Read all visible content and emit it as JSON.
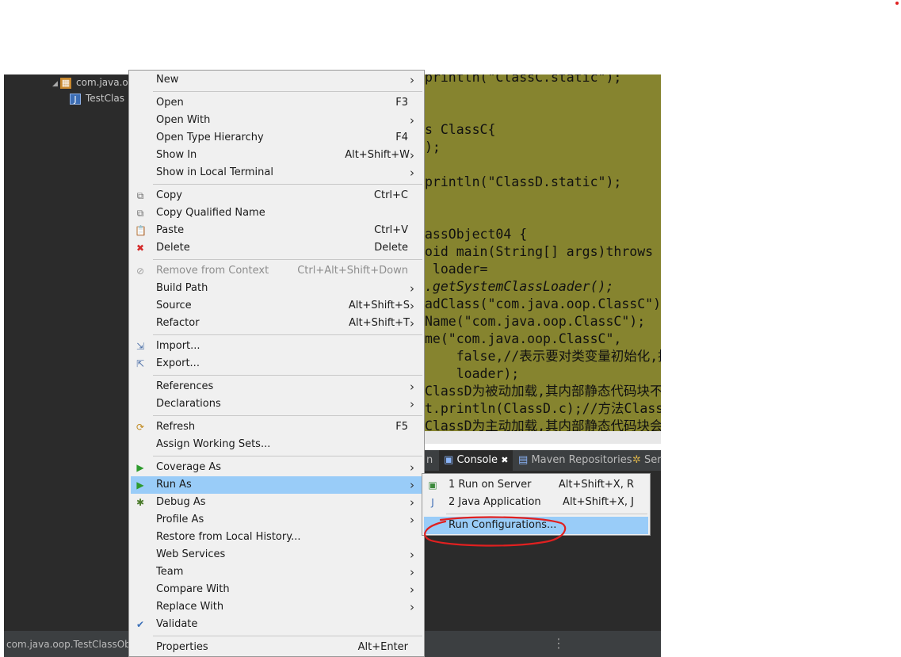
{
  "explorer": {
    "package": "com.java.o",
    "file": "TestClas"
  },
  "editor": {
    "lines": [
      {
        "text": "println(\"ClassC.static\");",
        "italic": false
      },
      {
        "text": "",
        "italic": false
      },
      {
        "text": "",
        "italic": false
      },
      {
        "text": "s ClassC{",
        "italic": false
      },
      {
        "text": ");",
        "italic": false
      },
      {
        "text": "",
        "italic": false
      },
      {
        "text": "println(\"ClassD.static\");",
        "italic": false
      },
      {
        "text": "",
        "italic": false
      },
      {
        "text": "",
        "italic": false
      },
      {
        "text": "assObject04 {",
        "italic": false
      },
      {
        "text": "oid main(String[] args)throws E",
        "italic": false
      },
      {
        "text": " loader=",
        "italic": false
      },
      {
        "text": ".getSystemClassLoader();",
        "italic": true
      },
      {
        "text": "adClass(\"com.java.oop.ClassC\");",
        "italic": false
      },
      {
        "text": "Name(\"com.java.oop.ClassC\");",
        "italic": false
      },
      {
        "text": "me(\"com.java.oop.ClassC\",",
        "italic": false
      },
      {
        "text": "    false,//表示要对类变量初始化,执行",
        "italic": false
      },
      {
        "text": "    loader);",
        "italic": false
      },
      {
        "text": "ClassD为被动加载,其内部静态代码块不会执",
        "italic": false
      },
      {
        "text": "t.println(ClassD.c);//方法ClassC",
        "italic": false
      },
      {
        "text": "ClassD为主动加载,其内部静态代码块会执行",
        "italic": false
      }
    ]
  },
  "console_tabs": {
    "left_partial": "n",
    "console": "Console",
    "close": "✖",
    "maven": "Maven Repositories",
    "right_partial": "Ser"
  },
  "status": {
    "text": "com.java.oop.TestClassObj",
    "dots": "⋮"
  },
  "context_menu": {
    "items": [
      {
        "label": "New",
        "accel": "",
        "submenu": true,
        "icon": "",
        "disabled": false,
        "highlighted": false
      },
      {
        "sep": true
      },
      {
        "label": "Open",
        "accel": "F3",
        "submenu": false,
        "icon": "",
        "disabled": false,
        "highlighted": false
      },
      {
        "label": "Open With",
        "accel": "",
        "submenu": true,
        "icon": "",
        "disabled": false,
        "highlighted": false
      },
      {
        "label": "Open Type Hierarchy",
        "accel": "F4",
        "submenu": false,
        "icon": "",
        "disabled": false,
        "highlighted": false
      },
      {
        "label": "Show In",
        "accel": "Alt+Shift+W",
        "submenu": true,
        "icon": "",
        "disabled": false,
        "highlighted": false
      },
      {
        "label": "Show in Local Terminal",
        "accel": "",
        "submenu": true,
        "icon": "",
        "disabled": false,
        "highlighted": false
      },
      {
        "sep": true
      },
      {
        "label": "Copy",
        "accel": "Ctrl+C",
        "submenu": false,
        "icon": "copy-icon",
        "disabled": false,
        "highlighted": false
      },
      {
        "label": "Copy Qualified Name",
        "accel": "",
        "submenu": false,
        "icon": "copy-qualified-name-icon",
        "disabled": false,
        "highlighted": false
      },
      {
        "label": "Paste",
        "accel": "Ctrl+V",
        "submenu": false,
        "icon": "paste-icon",
        "disabled": false,
        "highlighted": false
      },
      {
        "label": "Delete",
        "accel": "Delete",
        "submenu": false,
        "icon": "delete-icon",
        "disabled": false,
        "highlighted": false
      },
      {
        "sep": true
      },
      {
        "label": "Remove from Context",
        "accel": "Ctrl+Alt+Shift+Down",
        "submenu": false,
        "icon": "remove-context-icon",
        "disabled": true,
        "highlighted": false
      },
      {
        "label": "Build Path",
        "accel": "",
        "submenu": true,
        "icon": "",
        "disabled": false,
        "highlighted": false
      },
      {
        "label": "Source",
        "accel": "Alt+Shift+S",
        "submenu": true,
        "icon": "",
        "disabled": false,
        "highlighted": false
      },
      {
        "label": "Refactor",
        "accel": "Alt+Shift+T",
        "submenu": true,
        "icon": "",
        "disabled": false,
        "highlighted": false
      },
      {
        "sep": true
      },
      {
        "label": "Import...",
        "accel": "",
        "submenu": false,
        "icon": "import-icon",
        "disabled": false,
        "highlighted": false
      },
      {
        "label": "Export...",
        "accel": "",
        "submenu": false,
        "icon": "export-icon",
        "disabled": false,
        "highlighted": false
      },
      {
        "sep": true
      },
      {
        "label": "References",
        "accel": "",
        "submenu": true,
        "icon": "",
        "disabled": false,
        "highlighted": false
      },
      {
        "label": "Declarations",
        "accel": "",
        "submenu": true,
        "icon": "",
        "disabled": false,
        "highlighted": false
      },
      {
        "sep": true
      },
      {
        "label": "Refresh",
        "accel": "F5",
        "submenu": false,
        "icon": "refresh-icon",
        "disabled": false,
        "highlighted": false
      },
      {
        "label": "Assign Working Sets...",
        "accel": "",
        "submenu": false,
        "icon": "",
        "disabled": false,
        "highlighted": false
      },
      {
        "sep": true
      },
      {
        "label": "Coverage As",
        "accel": "",
        "submenu": true,
        "icon": "coverage-icon",
        "disabled": false,
        "highlighted": false
      },
      {
        "label": "Run As",
        "accel": "",
        "submenu": true,
        "icon": "run-icon",
        "disabled": false,
        "highlighted": true
      },
      {
        "label": "Debug As",
        "accel": "",
        "submenu": true,
        "icon": "debug-icon",
        "disabled": false,
        "highlighted": false
      },
      {
        "label": "Profile As",
        "accel": "",
        "submenu": true,
        "icon": "",
        "disabled": false,
        "highlighted": false
      },
      {
        "label": "Restore from Local History...",
        "accel": "",
        "submenu": false,
        "icon": "",
        "disabled": false,
        "highlighted": false
      },
      {
        "label": "Web Services",
        "accel": "",
        "submenu": true,
        "icon": "",
        "disabled": false,
        "highlighted": false
      },
      {
        "label": "Team",
        "accel": "",
        "submenu": true,
        "icon": "",
        "disabled": false,
        "highlighted": false
      },
      {
        "label": "Compare With",
        "accel": "",
        "submenu": true,
        "icon": "",
        "disabled": false,
        "highlighted": false
      },
      {
        "label": "Replace With",
        "accel": "",
        "submenu": true,
        "icon": "",
        "disabled": false,
        "highlighted": false
      },
      {
        "label": "Validate",
        "accel": "",
        "submenu": false,
        "icon": "checkmark-icon",
        "disabled": false,
        "highlighted": false
      },
      {
        "sep": true
      },
      {
        "label": "Properties",
        "accel": "Alt+Enter",
        "submenu": false,
        "icon": "",
        "disabled": false,
        "highlighted": false
      }
    ]
  },
  "run_as_submenu": {
    "items": [
      {
        "label": "1 Run on Server",
        "accel": "Alt+Shift+X, R",
        "icon": "server-run-icon",
        "highlighted": false
      },
      {
        "label": "2 Java Application",
        "accel": "Alt+Shift+X, J",
        "icon": "java-application-icon",
        "highlighted": false
      },
      {
        "sep": true
      },
      {
        "label": "Run Configurations...",
        "accel": "",
        "icon": "",
        "highlighted": true
      }
    ]
  },
  "icon_glyphs": {
    "copy-icon": "⧉",
    "copy-qualified-name-icon": "⧉",
    "paste-icon": "📋",
    "delete-icon": "✖",
    "remove-context-icon": "⊘",
    "import-icon": "⇲",
    "export-icon": "⇱",
    "refresh-icon": "⟳",
    "coverage-icon": "▶",
    "run-icon": "▶",
    "debug-icon": "✱",
    "checkmark-icon": "✔",
    "server-run-icon": "▣",
    "java-application-icon": "J"
  },
  "icon_colors": {
    "delete-icon": "#d42a2a",
    "run-icon": "#2e9b2e",
    "coverage-icon": "#2e9b2e",
    "debug-icon": "#4a7a2a",
    "refresh-icon": "#c08a20",
    "import-icon": "#4b6fa8",
    "export-icon": "#4b6fa8",
    "checkmark-icon": "#3a6fb8",
    "server-run-icon": "#3b8a3b",
    "java-application-icon": "#3c6db4",
    "copy-icon": "#6a6a6a",
    "copy-qualified-name-icon": "#6a6a6a",
    "paste-icon": "#8a6a30",
    "remove-context-icon": "#a0a0a0"
  },
  "colors": {
    "menu_bg": "#f0f0f0",
    "highlight": "#99ccf8",
    "editor_bg": "#86842f",
    "annotation": "#e02020"
  }
}
